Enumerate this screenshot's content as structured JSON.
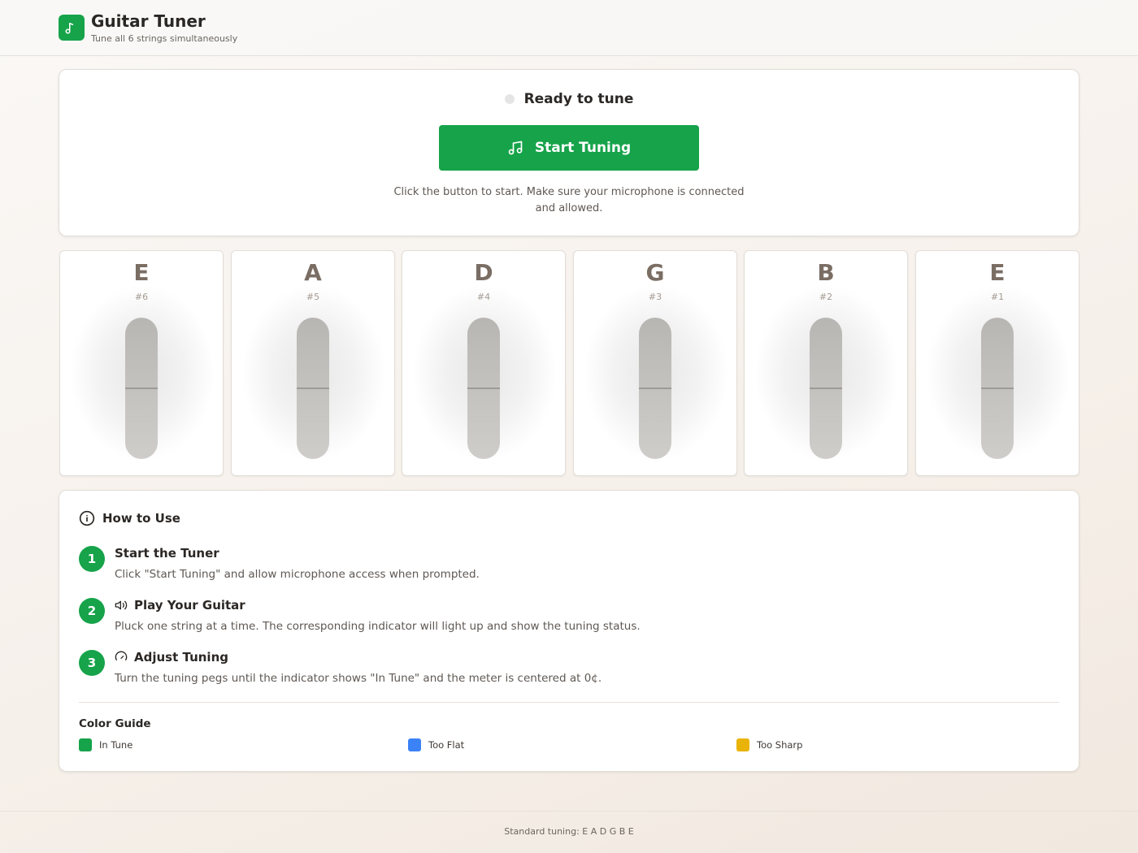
{
  "header": {
    "title": "Guitar Tuner",
    "subtitle": "Tune all 6 strings simultaneously",
    "logo_icon": "music-note-icon"
  },
  "tuner": {
    "status": "Ready to tune",
    "start_label": "Start Tuning",
    "start_icon": "music-notes-icon",
    "hint": "Click the button to start. Make sure your microphone is connected and allowed."
  },
  "strings": [
    {
      "note": "E",
      "number": "#6"
    },
    {
      "note": "A",
      "number": "#5"
    },
    {
      "note": "D",
      "number": "#4"
    },
    {
      "note": "G",
      "number": "#3"
    },
    {
      "note": "B",
      "number": "#2"
    },
    {
      "note": "E",
      "number": "#1"
    }
  ],
  "help": {
    "title": "How to Use",
    "steps": [
      {
        "badge": "1",
        "title": "Start the Tuner",
        "desc": "Click \"Start Tuning\" and allow microphone access when prompted."
      },
      {
        "badge": "2",
        "title": "Play Your Guitar",
        "desc": "Pluck one string at a time. The corresponding indicator will light up and show the tuning status.",
        "icon": "speaker-icon"
      },
      {
        "badge": "3",
        "title": "Adjust Tuning",
        "desc": "Turn the tuning pegs until the indicator shows \"In Tune\" and the meter is centered at 0¢.",
        "icon": "gauge-icon"
      }
    ],
    "color_guide_title": "Color Guide",
    "legend": [
      {
        "label": "In Tune",
        "color": "#16a34a"
      },
      {
        "label": "Too Flat",
        "color": "#3b82f6"
      },
      {
        "label": "Too Sharp",
        "color": "#eab308"
      }
    ]
  },
  "footer": {
    "text": "Standard tuning: E A D G B E"
  },
  "colors": {
    "accent": "#16a34a",
    "idle_dot": "#e5e5e5"
  }
}
